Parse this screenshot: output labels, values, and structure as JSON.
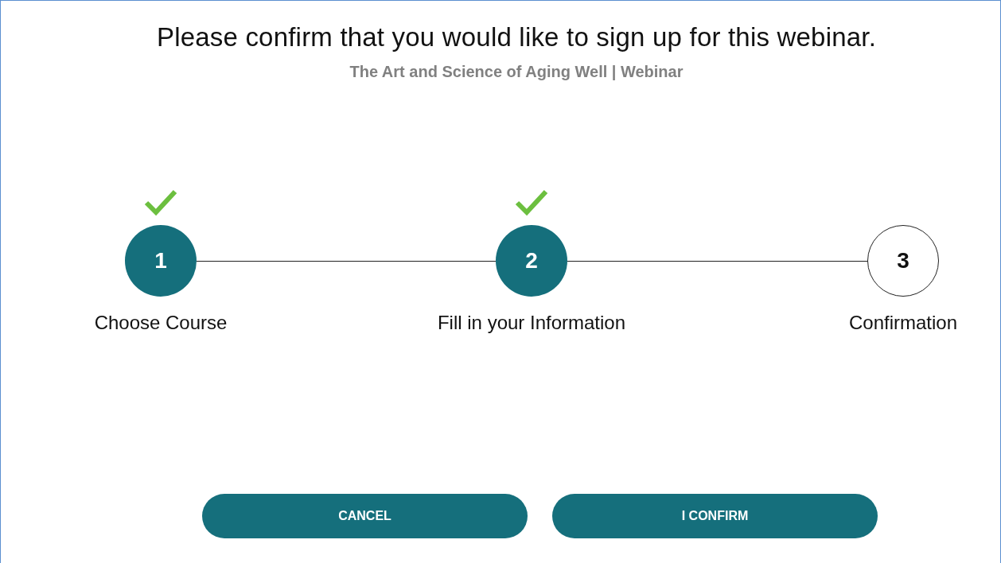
{
  "heading": {
    "title": "Please confirm that you would like to sign up for this webinar.",
    "subtitle": "The Art and Science of Aging Well | Webinar"
  },
  "steps": [
    {
      "number": "1",
      "label": "Choose Course",
      "completed": true
    },
    {
      "number": "2",
      "label": "Fill in your Information",
      "completed": true
    },
    {
      "number": "3",
      "label": "Confirmation",
      "completed": false
    }
  ],
  "buttons": [
    "CANCEL",
    "I CONFIRM"
  ]
}
